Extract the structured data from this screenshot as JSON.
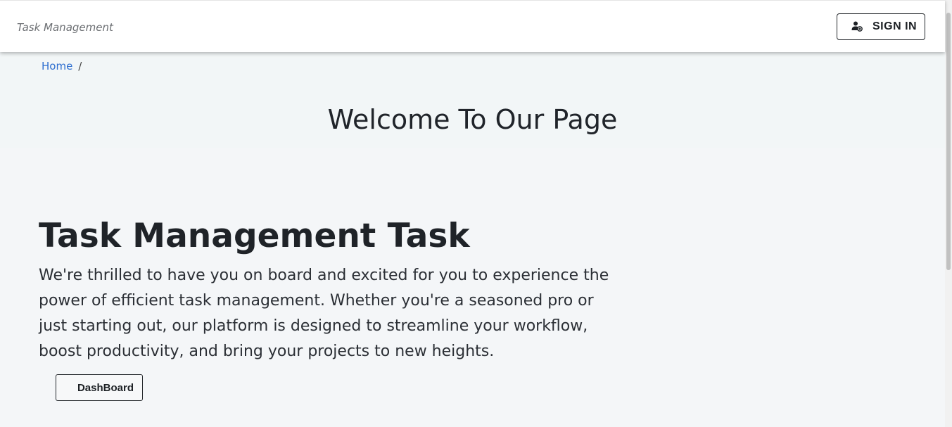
{
  "navbar": {
    "brand": "Task Management",
    "signin_label": "SIGN IN",
    "signin_icon": "user-add-icon"
  },
  "breadcrumb": {
    "home": "Home",
    "separator": "/"
  },
  "hero": {
    "title": "Welcome To Our Page"
  },
  "main": {
    "heading": "Task Management Task",
    "description": "We're thrilled to have you on board and excited for you to experience the power of efficient task management. Whether you're a seasoned pro or just starting out, our platform is designed to streamline your workflow, boost productivity, and bring your projects to new heights.",
    "dashboard_label": "DashBoard"
  },
  "colors": {
    "link": "#2f6fd0",
    "text": "#222831",
    "background": "#f4f6f8"
  }
}
